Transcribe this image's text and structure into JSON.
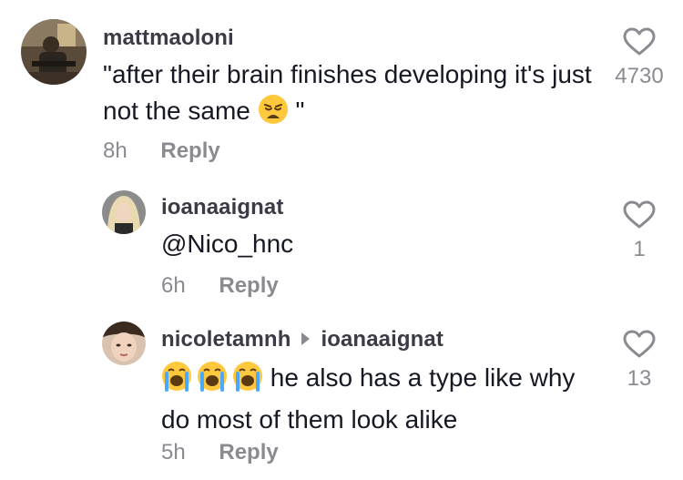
{
  "comments": [
    {
      "username": "mattmaoloni",
      "text": "\"after their brain finishes developing it's just not the same",
      "text_suffix": "\"",
      "emoji": "weary-face",
      "time": "8h",
      "reply_label": "Reply",
      "likes": "4730",
      "icon": "heart-outline-icon"
    },
    {
      "username": "ioanaaignat",
      "text": "@Nico_hnc",
      "time": "6h",
      "reply_label": "Reply",
      "likes": "1",
      "icon": "heart-outline-icon"
    },
    {
      "username": "nicoletamnh",
      "reply_to": "ioanaaignat",
      "emoji": "loudly-crying-face",
      "text": "he also has a type like why do most of them look alike",
      "time": "5h",
      "reply_label": "Reply",
      "likes": "13",
      "icon": "heart-outline-icon"
    }
  ],
  "colors": {
    "username": "#3a3b45",
    "text": "#161823",
    "muted": "#8a8b91",
    "emoji_face": "#FFC83D"
  }
}
